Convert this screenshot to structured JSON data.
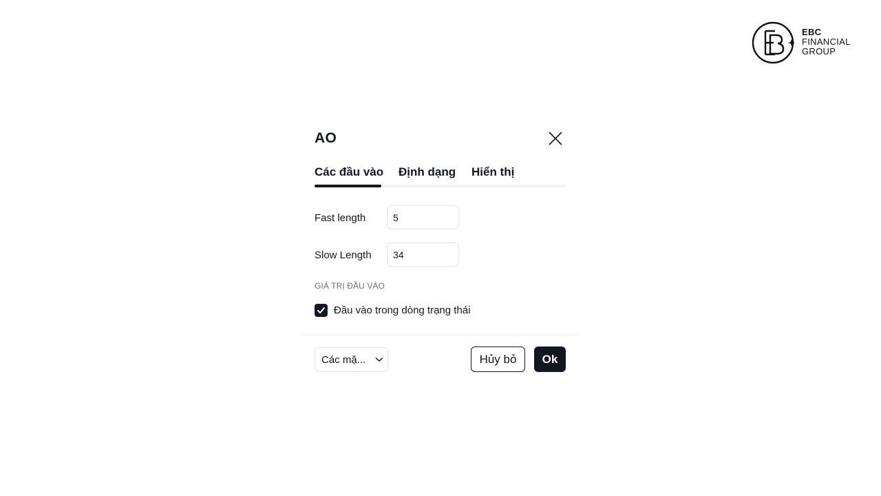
{
  "logo": {
    "line1": "EBC",
    "line2": "FINANCIAL",
    "line3": "GROUP",
    "icon": "ebc-logo-icon"
  },
  "dialog": {
    "title": "AO",
    "close_icon": "close-icon",
    "tabs": [
      {
        "label": "Các đầu vào",
        "active": true
      },
      {
        "label": "Định dạng",
        "active": false
      },
      {
        "label": "Hiển thị",
        "active": false
      }
    ],
    "fields": [
      {
        "label": "Fast length",
        "value": "5"
      },
      {
        "label": "Slow Length",
        "value": "34"
      }
    ],
    "section_label": "GIÁ TRỊ ĐẦU VÀO",
    "checkbox": {
      "label": "Đầu vào trong dòng trạng thái",
      "checked": true
    },
    "footer": {
      "select_value": "Các mặ...",
      "cancel_label": "Hủy bỏ",
      "ok_label": "Ok"
    }
  },
  "colors": {
    "text": "#131722",
    "border": "#e0e3eb",
    "accent": "#131722",
    "muted": "#6a6d78"
  }
}
